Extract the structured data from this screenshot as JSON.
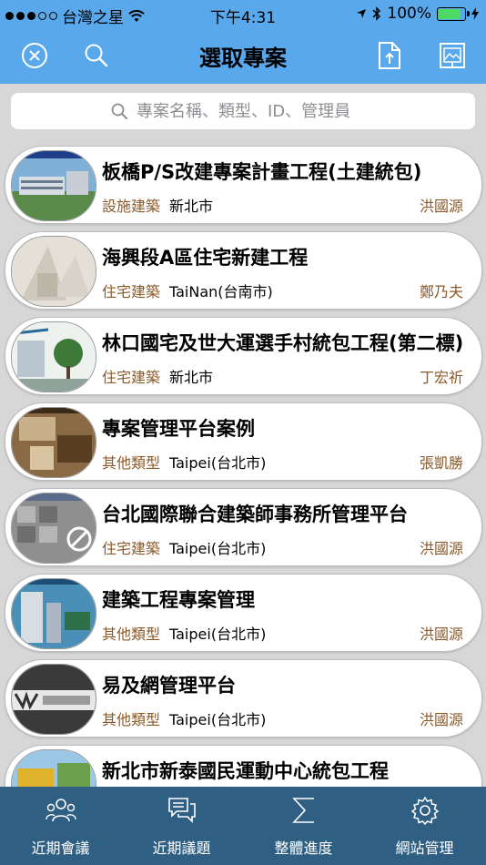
{
  "status": {
    "carrier": "台灣之星",
    "time": "下午4:31",
    "battery": "100%"
  },
  "header": {
    "title": "選取專案",
    "icons": [
      "close-circle-icon",
      "search-icon",
      "document-upload-icon",
      "image-upload-icon"
    ]
  },
  "search": {
    "placeholder": "專案名稱、類型、ID、管理員"
  },
  "projects": [
    {
      "title": "板橋P/S改建專案計畫工程(土建統包)",
      "type": "設施建築",
      "location": "新北市",
      "manager": "洪國源"
    },
    {
      "title": "海興段A區住宅新建工程",
      "type": "住宅建築",
      "location": "TaiNan(台南市)",
      "manager": "鄭乃夫"
    },
    {
      "title": "林口國宅及世大運選手村統包工程(第二標)",
      "type": "住宅建築",
      "location": "新北市",
      "manager": "丁宏祈"
    },
    {
      "title": "專案管理平台案例",
      "type": "其他類型",
      "location": "Taipei(台北市)",
      "manager": "張凱勝"
    },
    {
      "title": "台北國際聯合建築師事務所管理平台",
      "type": "住宅建築",
      "location": "Taipei(台北市)",
      "manager": "洪國源"
    },
    {
      "title": "建築工程專案管理",
      "type": "其他類型",
      "location": "Taipei(台北市)",
      "manager": "洪國源"
    },
    {
      "title": "易及網管理平台",
      "type": "其他類型",
      "location": "Taipei(台北市)",
      "manager": "洪國源"
    },
    {
      "title": "新北市新泰國民運動中心統包工程",
      "type": "",
      "location": "",
      "manager": ""
    }
  ],
  "tabs": [
    {
      "label": "近期會議",
      "icon": "meeting-people-icon"
    },
    {
      "label": "近期議題",
      "icon": "chat-bubbles-icon"
    },
    {
      "label": "整體進度",
      "icon": "sigma-icon"
    },
    {
      "label": "網站管理",
      "icon": "gear-icon"
    }
  ],
  "colors": {
    "header": "#5aa8ec",
    "tabbar": "#2f5f83",
    "meta_brown": "#8b5a2b"
  }
}
